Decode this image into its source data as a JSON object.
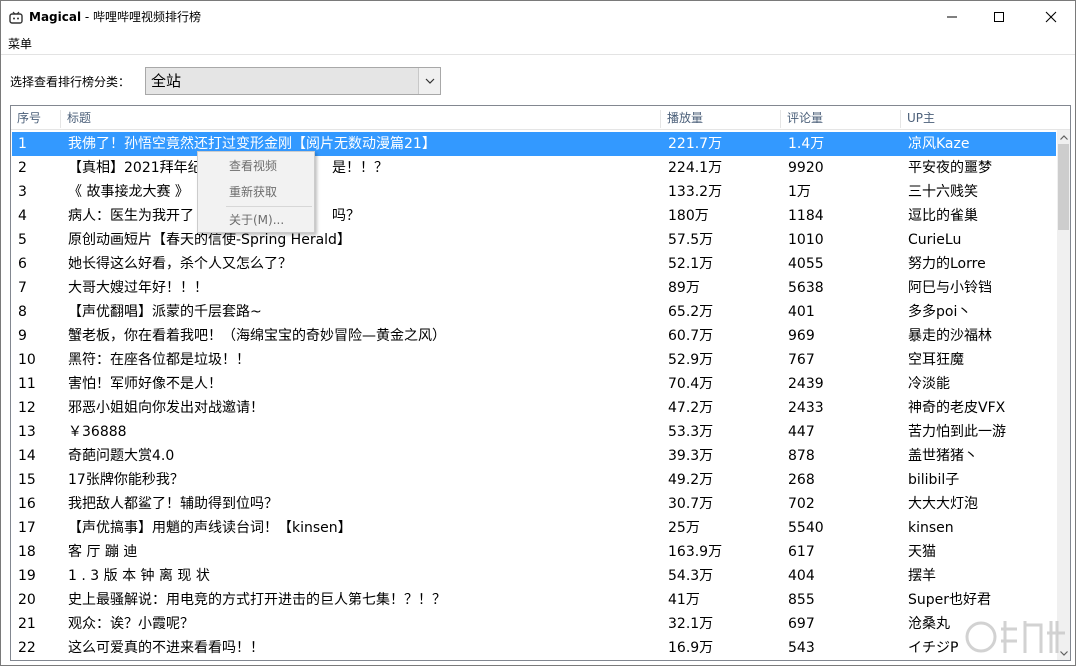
{
  "window": {
    "app_name": "Magical",
    "separator": " - ",
    "title": "哔哩哔哩视频排行榜",
    "minimize": "—",
    "maximize": "☐",
    "close": "✕",
    "icons": {
      "app": "app-icon",
      "minimize": "minimize-icon",
      "maximize": "maximize-icon",
      "close": "close-icon"
    }
  },
  "menubar": {
    "items": [
      {
        "label": "菜单"
      }
    ]
  },
  "category": {
    "label": "选择查看排行榜分类：",
    "selected": "全站"
  },
  "table": {
    "columns": [
      "序号",
      "标题",
      "播放量",
      "评论量",
      "UP主"
    ],
    "selected_row": 1,
    "rows": [
      {
        "no": "1",
        "title": "我佛了！孙悟空竟然还打过变形金刚【阅片无数动漫篇21】",
        "plays": "221.7万",
        "comments": "1.4万",
        "up": "凉风Kaze"
      },
      {
        "no": "2",
        "title": "【真相】2021拜年纪",
        "title_tail": "是！！？",
        "plays": "224.1万",
        "comments": "9920",
        "up": "平安夜的噩梦"
      },
      {
        "no": "3",
        "title": "《 故事接龙大赛 》",
        "plays": "133.2万",
        "comments": "1万",
        "up": "三十六贱笑"
      },
      {
        "no": "4",
        "title": "病人：医生为我开了",
        "title_tail": "吗？",
        "plays": "180万",
        "comments": "1184",
        "up": "逗比的雀巢"
      },
      {
        "no": "5",
        "title": "原创动画短片【春天的信使-Spring Herald】",
        "plays": "57.5万",
        "comments": "1010",
        "up": "CurieLu"
      },
      {
        "no": "6",
        "title": "她长得这么好看，杀个人又怎么了？",
        "plays": "52.1万",
        "comments": "4055",
        "up": "努力的Lorre"
      },
      {
        "no": "7",
        "title": "大哥大嫂过年好！！！",
        "plays": "89万",
        "comments": "5638",
        "up": "阿巳与小铃铛"
      },
      {
        "no": "8",
        "title": "【声优翻唱】派蒙的千层套路~",
        "plays": "65.2万",
        "comments": "401",
        "up": "多多poi丶"
      },
      {
        "no": "9",
        "title": "蟹老板，你在看着我吧！（海绵宝宝的奇妙冒险—黄金之风）",
        "plays": "60.7万",
        "comments": "969",
        "up": "暴走的沙福林"
      },
      {
        "no": "10",
        "title": "黑符：在座各位都是垃圾！！",
        "plays": "52.9万",
        "comments": "767",
        "up": "空耳狂魔"
      },
      {
        "no": "11",
        "title": "害怕！军师好像不是人！",
        "plays": "70.4万",
        "comments": "2439",
        "up": "冷淡能"
      },
      {
        "no": "12",
        "title": "邪恶小姐姐向你发出对战邀请！",
        "plays": "47.2万",
        "comments": "2433",
        "up": "神奇的老皮VFX"
      },
      {
        "no": "13",
        "title": "￥36888",
        "plays": "53.3万",
        "comments": "447",
        "up": "苦力怕到此一游"
      },
      {
        "no": "14",
        "title": "奇葩问题大赏4.0",
        "plays": "39.3万",
        "comments": "878",
        "up": "盖世猪猪丶"
      },
      {
        "no": "15",
        "title": "17张牌你能秒我？",
        "plays": "49.2万",
        "comments": "268",
        "up": "bilibil子"
      },
      {
        "no": "16",
        "title": "我把敌人都鲨了！辅助得到位吗？",
        "plays": "30.7万",
        "comments": "702",
        "up": "大大大灯泡"
      },
      {
        "no": "17",
        "title": "【声优搞事】用魈的声线读台词！【kinsen】",
        "plays": "25万",
        "comments": "5540",
        "up": "kinsen"
      },
      {
        "no": "18",
        "title": "客 厅 蹦 迪",
        "plays": "163.9万",
        "comments": "617",
        "up": "天猫"
      },
      {
        "no": "19",
        "title": "1 . 3 版 本 钟 离 现 状",
        "plays": "54.3万",
        "comments": "404",
        "up": "摆羊"
      },
      {
        "no": "20",
        "title": "史上最骚解说：用电竞的方式打开进击的巨人第七集！？！？",
        "plays": "41万",
        "comments": "855",
        "up": "Super也好君"
      },
      {
        "no": "21",
        "title": "观众：诶？小霞呢？",
        "plays": "32.1万",
        "comments": "697",
        "up": "沧桑丸"
      },
      {
        "no": "22",
        "title": "这么可爱真的不进来看看吗！！",
        "plays": "16.9万",
        "comments": "543",
        "up": "イチジP"
      }
    ]
  },
  "context_menu": {
    "items": [
      {
        "label": "查看视频"
      },
      {
        "label": "重新获取"
      },
      {
        "label": "关于(M)..."
      }
    ]
  },
  "colors": {
    "selection": "#3399ff",
    "header_text": "#4c607a",
    "menu_disabled": "#6d6d6d"
  }
}
